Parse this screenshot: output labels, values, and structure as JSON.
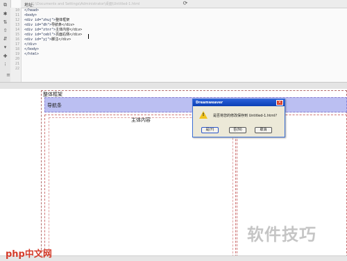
{
  "address_bar": {
    "label": "地址:",
    "value": "C:\\Documents and Settings\\Administrator\\桌面\\Untitled-1.html"
  },
  "code": {
    "line_numbers": [
      "10",
      "11",
      "12",
      "13",
      "14",
      "15",
      "16",
      "17",
      "18",
      "19",
      "20",
      "21",
      "22"
    ],
    "lines": [
      {
        "tag": "</head>",
        "text": ""
      },
      {
        "tag": "<body>",
        "text": ""
      },
      {
        "tag": "<div id=\"zhuj\">",
        "text": "整体框架"
      },
      {
        "tag": "<div id=\"dh\">",
        "text": "导航条</div>"
      },
      {
        "tag": "<div id=\"ztnr\">",
        "text": "主体内容</div>"
      },
      {
        "tag": "<div id=\"cebl\">",
        "text": "页面右侧</div>"
      },
      {
        "tag": "<div id=\"yj\">",
        "text": "脚注</div>"
      },
      {
        "tag": "</div>",
        "text": ""
      },
      {
        "tag": "</body>",
        "text": ""
      },
      {
        "tag": "</html>",
        "text": ""
      }
    ]
  },
  "design": {
    "body_label": "整体框架",
    "nav_label": "导航条",
    "main_label": "主体内容"
  },
  "dialog": {
    "title": "Dreamweaver",
    "message": "是否将您的修改保存到 Untitled-1.html?",
    "yes": "是(Y)",
    "no": "否(N)",
    "cancel": "取消"
  },
  "watermarks": {
    "php": "php中文网",
    "tips": "软件技巧"
  },
  "colors": {
    "nav_background": "#bbbff2",
    "dialog_title": "#0b3fb5",
    "warning": "#f2c31d"
  },
  "icons": [
    "refresh-icon",
    "warning-icon",
    "close-icon"
  ]
}
